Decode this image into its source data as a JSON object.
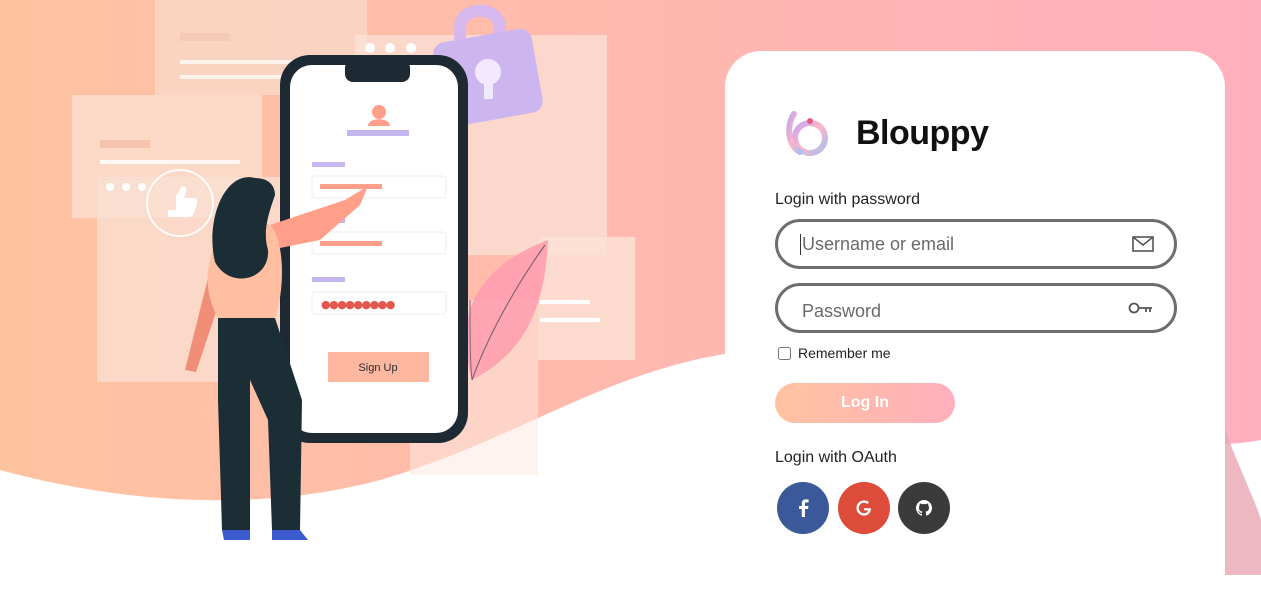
{
  "brand": {
    "name": "Blouppy",
    "logo_icon": "blouppy-logo-icon"
  },
  "illustration": {
    "signup_button_label": "Sign Up",
    "password_dots": "●●●●●●●●●"
  },
  "login": {
    "password_section_label": "Login with password",
    "username_placeholder": "Username or email",
    "username_icon": "mail-icon",
    "password_placeholder": "Password",
    "password_icon": "key-icon",
    "remember_label": "Remember me",
    "remember_checked": false,
    "submit_label": "Log In"
  },
  "oauth": {
    "section_label": "Login with OAuth",
    "providers": [
      {
        "name": "facebook",
        "icon": "facebook-icon",
        "color": "#3b5998"
      },
      {
        "name": "google",
        "icon": "google-icon",
        "color": "#dd4b39"
      },
      {
        "name": "github",
        "icon": "github-icon",
        "color": "#3a3a3a"
      }
    ]
  },
  "colors": {
    "peach": "#ffc3a0",
    "pink": "#ffafbd",
    "field_border": "#6e6e6e"
  }
}
